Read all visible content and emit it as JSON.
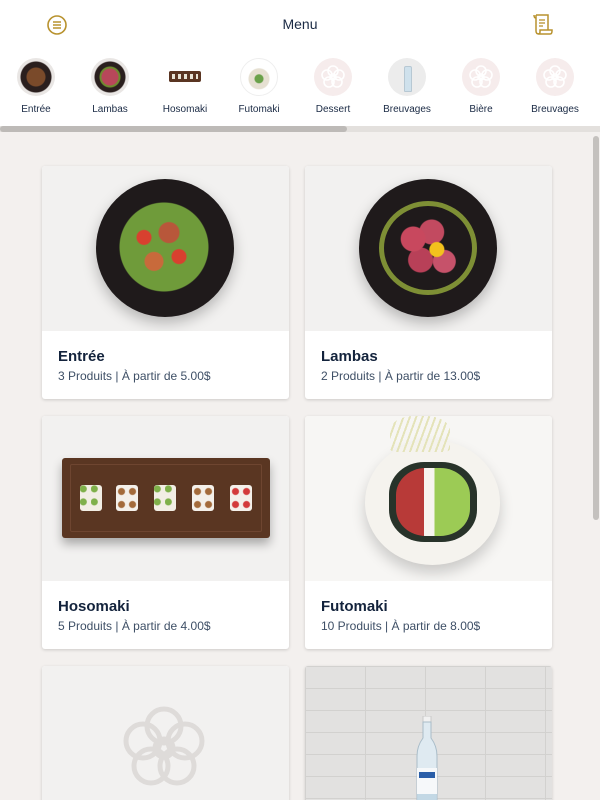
{
  "header": {
    "title": "Menu",
    "menu_icon": "hamburger-menu-icon",
    "receipt_icon": "receipt-icon",
    "accent_color": "#b8922e"
  },
  "categories": [
    {
      "label": "Entrée",
      "icon": "dish-thumbnail"
    },
    {
      "label": "Lambas",
      "icon": "dish-thumbnail"
    },
    {
      "label": "Hosomaki",
      "icon": "tray-thumbnail"
    },
    {
      "label": "Futomaki",
      "icon": "roll-thumbnail"
    },
    {
      "label": "Dessert",
      "icon": "flower-placeholder-icon"
    },
    {
      "label": "Breuvages",
      "icon": "bottle-thumbnail"
    },
    {
      "label": "Bière",
      "icon": "flower-placeholder-icon"
    },
    {
      "label": "Breuvages",
      "icon": "flower-placeholder-icon"
    }
  ],
  "cards": [
    {
      "name": "Entrée",
      "meta": "3 Produits | À partir de 5.00$"
    },
    {
      "name": "Lambas",
      "meta": "2 Produits | À partir de 13.00$"
    },
    {
      "name": "Hosomaki",
      "meta": "5 Produits | À partir de 4.00$"
    },
    {
      "name": "Futomaki",
      "meta": "10 Produits | À partir de 8.00$"
    },
    {
      "name": "",
      "meta": ""
    },
    {
      "name": "",
      "meta": ""
    }
  ]
}
